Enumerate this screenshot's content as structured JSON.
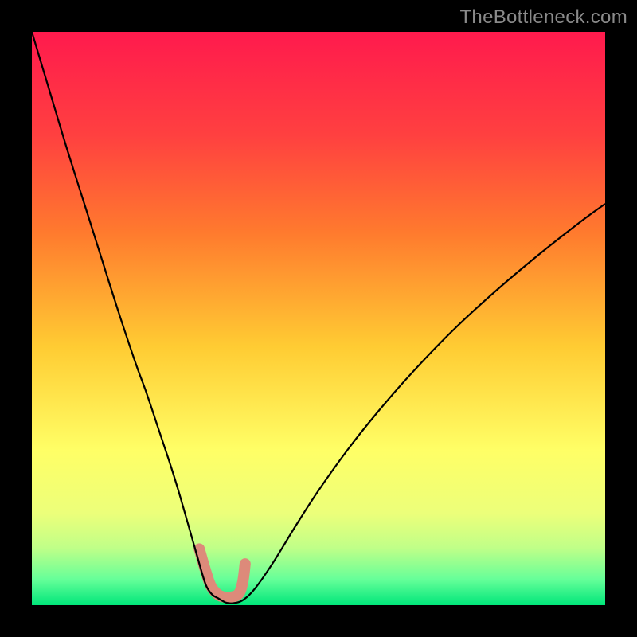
{
  "watermark": "TheBottleneck.com",
  "chart_data": {
    "type": "line",
    "title": "",
    "xlabel": "",
    "ylabel": "",
    "xlim": [
      0,
      100
    ],
    "ylim": [
      0,
      100
    ],
    "grid": false,
    "background_gradient": {
      "stops": [
        {
          "offset": 0.0,
          "color": "#ff1a4d"
        },
        {
          "offset": 0.18,
          "color": "#ff4040"
        },
        {
          "offset": 0.35,
          "color": "#ff7a2e"
        },
        {
          "offset": 0.55,
          "color": "#ffcc33"
        },
        {
          "offset": 0.73,
          "color": "#ffff66"
        },
        {
          "offset": 0.84,
          "color": "#ecff7a"
        },
        {
          "offset": 0.9,
          "color": "#c0ff88"
        },
        {
          "offset": 0.955,
          "color": "#66ff99"
        },
        {
          "offset": 1.0,
          "color": "#00e67a"
        }
      ]
    },
    "series": [
      {
        "name": "bottleneck-curve",
        "stroke": "#000000",
        "stroke_width": 2.2,
        "x": [
          0.0,
          3.0,
          6.0,
          9.0,
          12.0,
          15.0,
          18.0,
          20.0,
          22.0,
          24.0,
          25.5,
          27.0,
          28.0,
          29.0,
          29.8,
          30.5,
          31.5,
          32.5,
          34.0,
          35.5,
          37.0,
          39.0,
          42.0,
          46.0,
          50.0,
          55.0,
          60.0,
          66.0,
          73.0,
          80.0,
          88.0,
          96.0,
          100.0
        ],
        "y": [
          100.0,
          90.0,
          80.0,
          70.5,
          61.0,
          51.5,
          42.5,
          37.0,
          31.0,
          25.0,
          20.2,
          15.0,
          11.5,
          8.0,
          5.2,
          3.2,
          1.8,
          1.2,
          0.4,
          0.4,
          1.0,
          3.0,
          7.3,
          13.8,
          20.0,
          27.0,
          33.3,
          40.2,
          47.5,
          54.0,
          60.8,
          67.1,
          70.0
        ]
      },
      {
        "name": "marker-band",
        "stroke": "#dd8a7a",
        "stroke_width": 14,
        "linecap": "round",
        "x": [
          29.2,
          30.3,
          31.2,
          32.4,
          33.6,
          34.8,
          36.1,
          36.8,
          37.2
        ],
        "y": [
          9.8,
          6.0,
          3.4,
          1.9,
          1.4,
          1.4,
          2.0,
          4.1,
          7.2
        ]
      }
    ]
  }
}
